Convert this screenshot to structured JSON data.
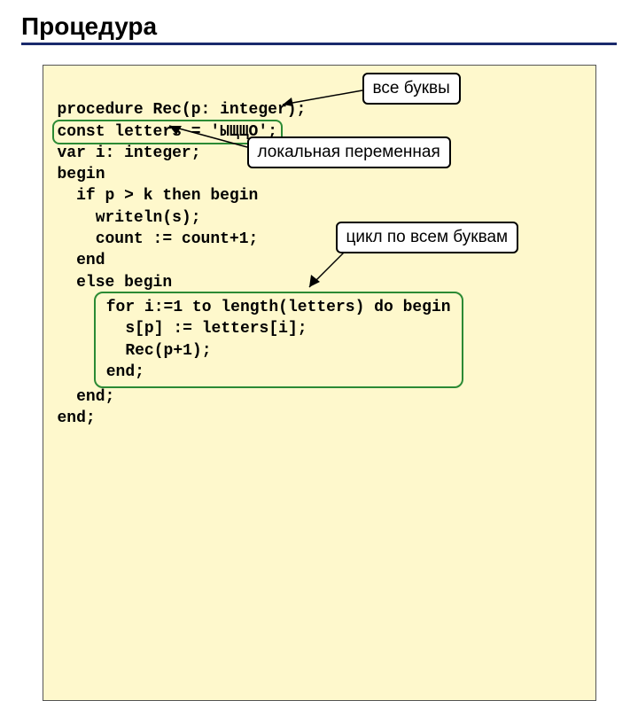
{
  "title": "Процедура",
  "code": {
    "l1": "procedure Rec(p: integer);",
    "l2a": "const letters = 'ЫЩЩО';",
    "l3": "var i: integer;",
    "l4": "begin",
    "l4note": "локальная переменная",
    "l5": "  if p > k then begin",
    "l6": "    writeln(s);",
    "l7": "    count := count+1;",
    "l8": "  end",
    "l9": "  else begin",
    "l10": "for i:=1 to length(letters) do begin",
    "l11": "  s[p] := letters[i];",
    "l12": "  Rec(p+1);",
    "l13": "end;",
    "l14": "  end;",
    "l15": "end;"
  },
  "callouts": {
    "c1": "все буквы",
    "c2": "локальная переменная",
    "c3": "цикл по всем буквам"
  }
}
